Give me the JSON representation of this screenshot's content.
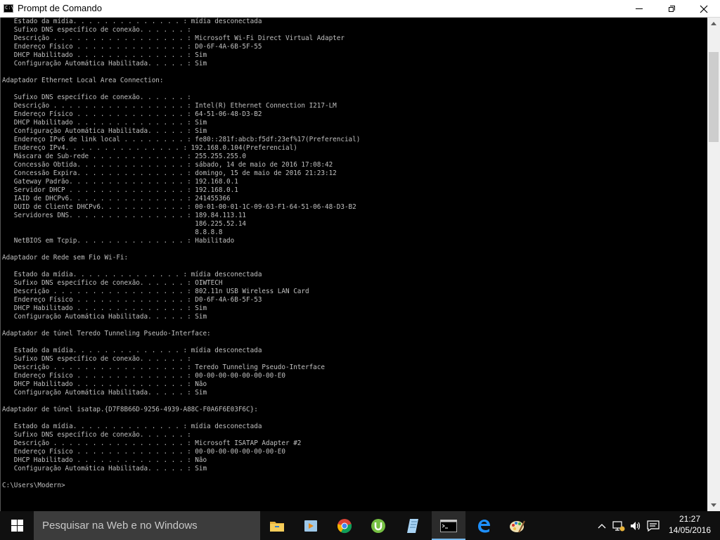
{
  "window": {
    "title": "Prompt de Comando",
    "icon_label": "C:\\_"
  },
  "console": {
    "lines": [
      "   Estado da mídia. . . . . . . . . . . . . . : mídia desconectada",
      "   Sufixo DNS específico de conexão. . . . . . :",
      "   Descrição . . . . . . . . . . . . . . . . . : Microsoft Wi-Fi Direct Virtual Adapter",
      "   Endereço Físico . . . . . . . . . . . . . . : D0-6F-4A-6B-5F-55",
      "   DHCP Habilitado . . . . . . . . . . . . . . : Sim",
      "   Configuração Automática Habilitada. . . . . : Sim",
      "",
      "Adaptador Ethernet Local Area Connection:",
      "",
      "   Sufixo DNS específico de conexão. . . . . . :",
      "   Descrição . . . . . . . . . . . . . . . . . : Intel(R) Ethernet Connection I217-LM",
      "   Endereço Físico . . . . . . . . . . . . . . : 64-51-06-48-D3-B2",
      "   DHCP Habilitado . . . . . . . . . . . . . . : Sim",
      "   Configuração Automática Habilitada. . . . . : Sim",
      "   Endereço IPv6 de link local . . . . . . . . : fe80::281f:abcb:f5df:23ef%17(Preferencial)",
      "   Endereço IPv4. . . . . . . . . . . . . . . : 192.168.0.104(Preferencial)",
      "   Máscara de Sub-rede . . . . . . . . . . . . : 255.255.255.0",
      "   Concessão Obtida. . . . . . . . . . . . . . : sábado, 14 de maio de 2016 17:08:42",
      "   Concessão Expira. . . . . . . . . . . . . . : domingo, 15 de maio de 2016 21:23:12",
      "   Gateway Padrão. . . . . . . . . . . . . . . : 192.168.0.1",
      "   Servidor DHCP . . . . . . . . . . . . . . . : 192.168.0.1",
      "   IAID de DHCPv6. . . . . . . . . . . . . . . : 241455366",
      "   DUID de Cliente DHCPv6. . . . . . . . . . . : 00-01-00-01-1C-09-63-F1-64-51-06-48-D3-B2",
      "   Servidores DNS. . . . . . . . . . . . . . . : 189.84.113.11",
      "                                                 186.225.52.14",
      "                                                 8.8.8.8",
      "   NetBIOS em Tcpip. . . . . . . . . . . . . . : Habilitado",
      "",
      "Adaptador de Rede sem Fio Wi-Fi:",
      "",
      "   Estado da mídia. . . . . . . . . . . . . . : mídia desconectada",
      "   Sufixo DNS específico de conexão. . . . . . : OIWTECH",
      "   Descrição . . . . . . . . . . . . . . . . . : 802.11n USB Wireless LAN Card",
      "   Endereço Físico . . . . . . . . . . . . . . : D0-6F-4A-6B-5F-53",
      "   DHCP Habilitado . . . . . . . . . . . . . . : Sim",
      "   Configuração Automática Habilitada. . . . . : Sim",
      "",
      "Adaptador de túnel Teredo Tunneling Pseudo-Interface:",
      "",
      "   Estado da mídia. . . . . . . . . . . . . . : mídia desconectada",
      "   Sufixo DNS específico de conexão. . . . . . :",
      "   Descrição . . . . . . . . . . . . . . . . . : Teredo Tunneling Pseudo-Interface",
      "   Endereço Físico . . . . . . . . . . . . . . : 00-00-00-00-00-00-00-E0",
      "   DHCP Habilitado . . . . . . . . . . . . . . : Não",
      "   Configuração Automática Habilitada. . . . . : Sim",
      "",
      "Adaptador de túnel isatap.{D7F8B66D-9256-4939-A88C-F0A6F6E03F6C}:",
      "",
      "   Estado da mídia. . . . . . . . . . . . . . : mídia desconectada",
      "   Sufixo DNS específico de conexão. . . . . . :",
      "   Descrição . . . . . . . . . . . . . . . . . : Microsoft ISATAP Adapter #2",
      "   Endereço Físico . . . . . . . . . . . . . . : 00-00-00-00-00-00-00-E0",
      "   DHCP Habilitado . . . . . . . . . . . . . . : Não",
      "   Configuração Automática Habilitada. . . . . : Sim",
      "",
      "C:\\Users\\Modern>"
    ]
  },
  "taskbar": {
    "search_placeholder": "Pesquisar na Web e no Windows",
    "apps": [
      {
        "icon": "file-explorer-icon",
        "color": "#e8b33b"
      },
      {
        "icon": "media-player-icon",
        "color": "#9ec8e8"
      },
      {
        "icon": "chrome-icon",
        "color": "#4caf50"
      },
      {
        "icon": "utorrent-icon",
        "color": "#76c043"
      },
      {
        "icon": "notepad-icon",
        "color": "#a9d4f5"
      },
      {
        "icon": "command-prompt-icon",
        "color": "#ffffff"
      },
      {
        "icon": "edge-icon",
        "color": "#1e90ff"
      },
      {
        "icon": "paint-icon",
        "color": "#f0c040"
      }
    ],
    "clock": {
      "time": "21:27",
      "date": "14/05/2016"
    }
  }
}
